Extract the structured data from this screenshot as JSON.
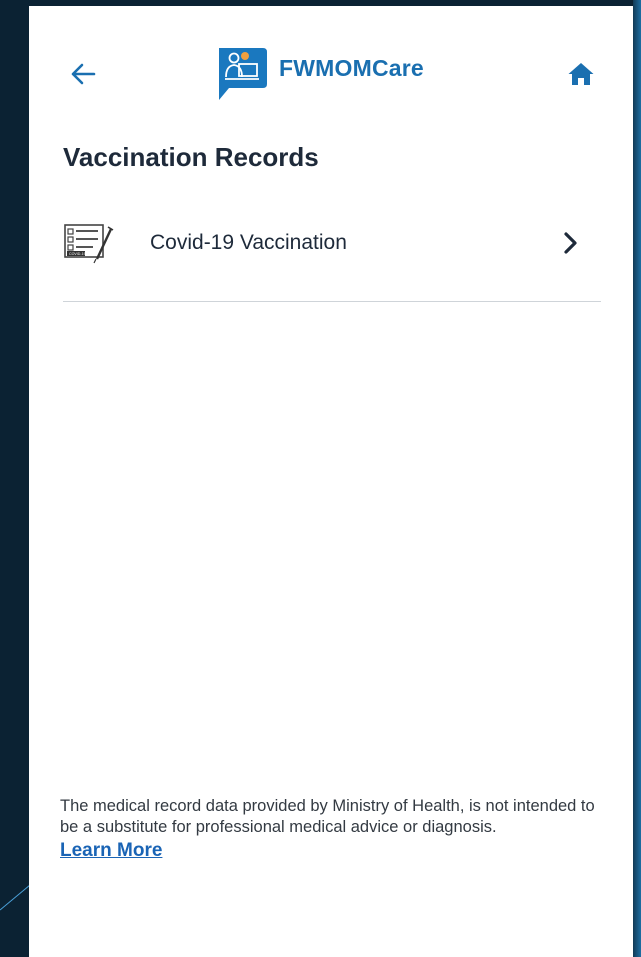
{
  "app": {
    "name": "FWMOMCare",
    "brand_color": "#1a6fb0"
  },
  "app_bar": {
    "back_icon": "arrow-left-icon",
    "home_icon": "home-icon"
  },
  "page": {
    "title": "Vaccination Records"
  },
  "records": [
    {
      "label": "Covid-19 Vaccination",
      "icon": "vaccination-certificate-icon",
      "icon_caption": "COVID-19"
    }
  ],
  "footer": {
    "disclaimer": "The medical record data provided by Ministry of Health, is not intended to be a substitute for professional medical advice or diagnosis.",
    "learn_more": "Learn More"
  }
}
